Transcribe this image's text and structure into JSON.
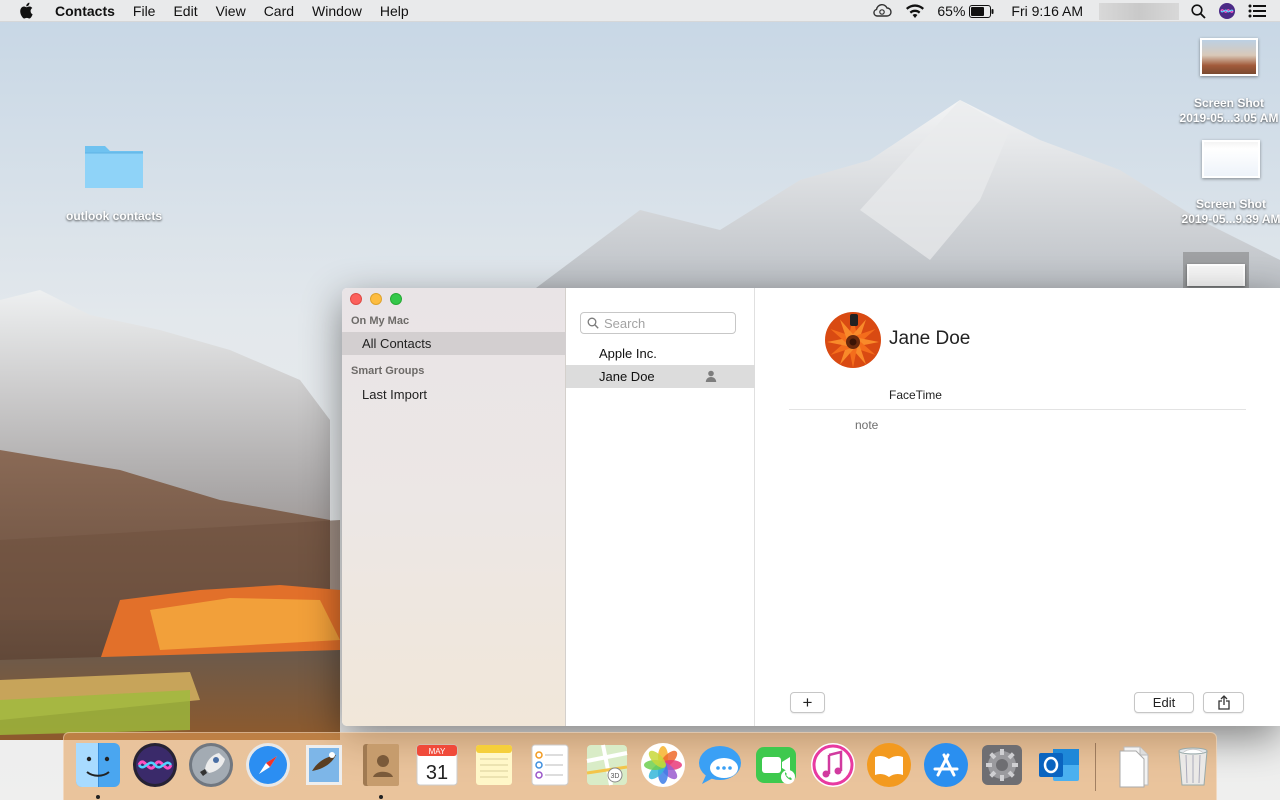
{
  "menubar": {
    "app_name": "Contacts",
    "menus": [
      "File",
      "Edit",
      "View",
      "Card",
      "Window",
      "Help"
    ],
    "battery_percent": "65%",
    "clock": "Fri 9:16 AM"
  },
  "desktop": {
    "folder_label": "outlook contacts",
    "screenshots": [
      {
        "label_line1": "Screen Shot",
        "label_line2": "2019-05...3.05 AM"
      },
      {
        "label_line1": "Screen Shot",
        "label_line2": "2019-05...9.39 AM"
      }
    ]
  },
  "sidebar": {
    "section_on_my_mac": "On My Mac",
    "all_contacts": "All Contacts",
    "section_smart_groups": "Smart Groups",
    "last_import": "Last Import"
  },
  "list": {
    "search_placeholder": "Search",
    "rows": [
      "Apple Inc.",
      "Jane Doe"
    ]
  },
  "detail": {
    "name": "Jane Doe",
    "facetime_label": "FaceTime",
    "note_label": "note",
    "add_button": "+",
    "edit_button": "Edit"
  },
  "dock": {
    "apps": [
      "Finder",
      "Siri",
      "Launchpad",
      "Safari",
      "Mail",
      "Contacts",
      "Calendar",
      "Notes",
      "Reminders",
      "Maps",
      "Photos",
      "Messages",
      "FaceTime",
      "iTunes",
      "iBooks",
      "App Store",
      "System Preferences",
      "Outlook",
      "Documents",
      "Trash"
    ],
    "calendar_month": "MAY",
    "calendar_day": "31"
  },
  "colors": {
    "accent": "#1f7ae0",
    "sidebar_selected": "#d3cfd0",
    "list_selected": "#dcdcdc"
  }
}
